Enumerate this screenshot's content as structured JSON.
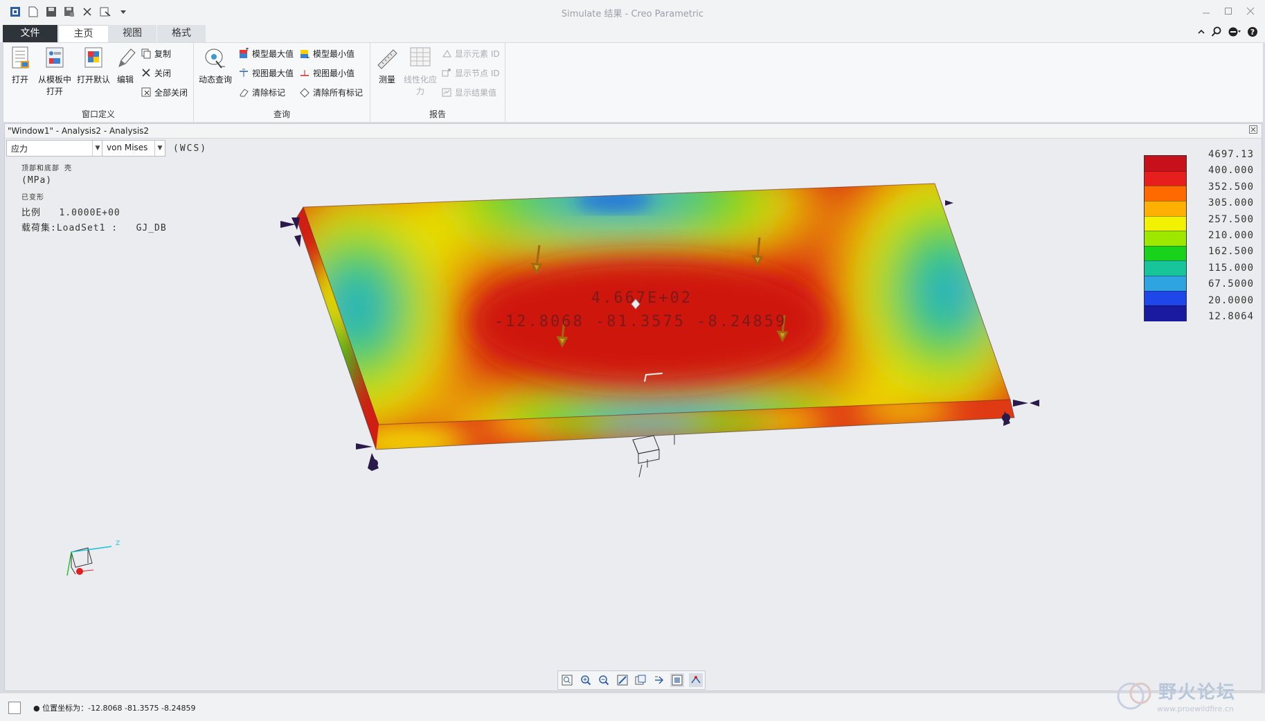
{
  "window": {
    "title": "Simulate 结果 - Creo Parametric"
  },
  "tabs": {
    "file": "文件",
    "home": "主页",
    "view": "视图",
    "format": "格式"
  },
  "ribbon": {
    "group1": {
      "label": "窗口定义",
      "open": "打开",
      "open_template_line1": "从模板中",
      "open_template_line2": "打开",
      "open_default": "打开默认",
      "edit": "编辑",
      "copy": "复制",
      "close": "关闭",
      "close_all": "全部关闭"
    },
    "group2": {
      "label": "查询",
      "dynamic_query": "动态查询",
      "model_max": "模型最大值",
      "model_min": "模型最小值",
      "view_max": "视图最大值",
      "view_min": "视图最小值",
      "clear_marks": "清除标记",
      "clear_all_marks": "清除所有标记"
    },
    "group3": {
      "label": "报告",
      "measure": "测量",
      "linearize_line1": "线性化应",
      "linearize_line2": "力",
      "show_element_id": "显示元素 ID",
      "show_node_id": "显示节点 ID",
      "show_result_value": "显示结果值"
    }
  },
  "viewport": {
    "title": "\"Window1\" - Analysis2 - Analysis2",
    "quantity": "应力",
    "component": "von Mises",
    "wcs": "(WCS)",
    "info": {
      "surface": "顶部和底部 壳",
      "units": "(MPa)",
      "deformed": "已变形",
      "scale": "比例   1.0000E+00",
      "loadset": "载荷集:LoadSet1 :   GJ_DB"
    },
    "probe": {
      "value": "4.667E+02",
      "coords": "-12.8068  -81.3575  -8.24859"
    }
  },
  "legend": {
    "values": [
      "4697.13",
      "400.000",
      "352.500",
      "305.000",
      "257.500",
      "210.000",
      "162.500",
      "115.000",
      "67.5000",
      "20.0000",
      "12.8064"
    ],
    "colors": [
      "#c8101a",
      "#e61e1e",
      "#ff6a00",
      "#ffb000",
      "#f2f200",
      "#9ee800",
      "#19d21c",
      "#18c49a",
      "#2ea4e0",
      "#1e46e8",
      "#1a1aa0"
    ]
  },
  "statusbar": {
    "text": "● 位置坐标为：-12.8068  -81.3575  -8.24859"
  },
  "watermark": {
    "text": "野火论坛",
    "url": "www.proewildfire.cn"
  }
}
